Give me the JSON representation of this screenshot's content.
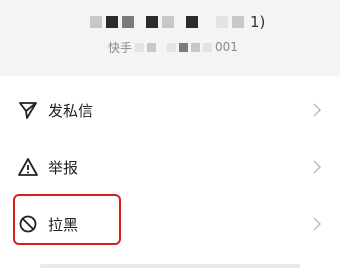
{
  "header": {
    "name_suffix": "1)",
    "handle_prefix": "快手",
    "handle_suffix": "001"
  },
  "menu": {
    "items": [
      {
        "label": "发私信",
        "icon": "send-icon"
      },
      {
        "label": "举报",
        "icon": "warning-icon"
      },
      {
        "label": "拉黑",
        "icon": "block-icon"
      }
    ]
  },
  "colors": {
    "highlight": "#d81e1e",
    "header_bg": "#f4f4f4"
  }
}
